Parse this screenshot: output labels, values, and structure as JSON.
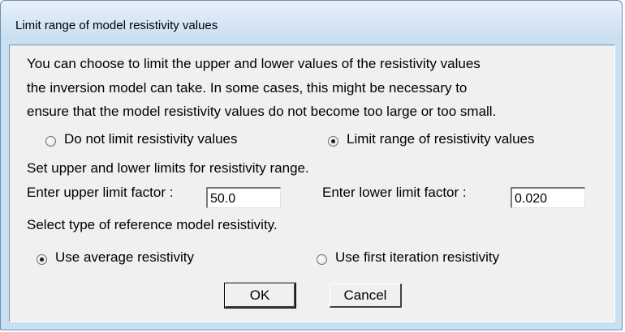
{
  "window": {
    "title": "Limit range of model resistivity values"
  },
  "description": {
    "line1": "You can choose to limit the upper and lower values of the resistivity values",
    "line2": "the inversion model can take. In some cases, this might be necessary to",
    "line3": "ensure that the model resistivity values do not become too large or too small."
  },
  "limit_mode": {
    "options": [
      {
        "label": "Do not limit resistivity values",
        "selected": false
      },
      {
        "label": "Limit range of resistivity values",
        "selected": true
      }
    ]
  },
  "limits": {
    "heading": "Set upper and lower limits for resistivity range.",
    "upper_label": "Enter upper limit factor :",
    "upper_value": "50.0",
    "lower_label": "Enter lower limit factor :",
    "lower_value": "0.020"
  },
  "reference": {
    "heading": "Select type of reference model resistivity.",
    "options": [
      {
        "label": "Use average resistivity",
        "selected": true
      },
      {
        "label": "Use first iteration resistivity",
        "selected": false
      }
    ]
  },
  "buttons": {
    "ok_label": "OK",
    "cancel_label": "Cancel"
  }
}
